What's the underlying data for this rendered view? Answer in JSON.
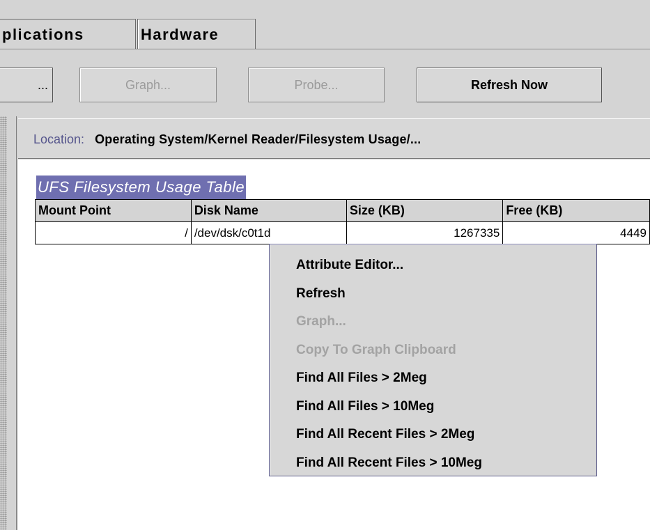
{
  "tabs": [
    {
      "label": "plications"
    },
    {
      "label": "Hardware"
    }
  ],
  "toolbar": {
    "prev_label": "...",
    "graph_label": "Graph...",
    "probe_label": "Probe...",
    "refresh_label": "Refresh Now"
  },
  "location": {
    "label": "Location:",
    "path": "Operating System/Kernel Reader/Filesystem Usage/..."
  },
  "table": {
    "title": "UFS Filesystem Usage Table",
    "headers": [
      "Mount Point",
      "Disk Name",
      "Size (KB)",
      "Free (KB)"
    ],
    "rows": [
      [
        "/",
        "/dev/dsk/c0t1d",
        "1267335",
        "4449"
      ]
    ]
  },
  "context_menu": {
    "items": [
      {
        "label": "Attribute Editor...",
        "enabled": true
      },
      {
        "label": "Refresh",
        "enabled": true
      },
      {
        "label": "Graph...",
        "enabled": false
      },
      {
        "label": "Copy To Graph Clipboard",
        "enabled": false
      },
      {
        "label": "Find All Files > 2Meg",
        "enabled": true
      },
      {
        "label": "Find All Files > 10Meg",
        "enabled": true
      },
      {
        "label": "Find All Recent Files > 2Meg",
        "enabled": true
      },
      {
        "label": "Find All Recent Files > 10Meg",
        "enabled": true
      }
    ]
  },
  "colors": {
    "background": "#d4d4d4",
    "selection": "#6f6fb0",
    "location_label": "#55558c",
    "disabled_text": "#9b9b9b"
  }
}
